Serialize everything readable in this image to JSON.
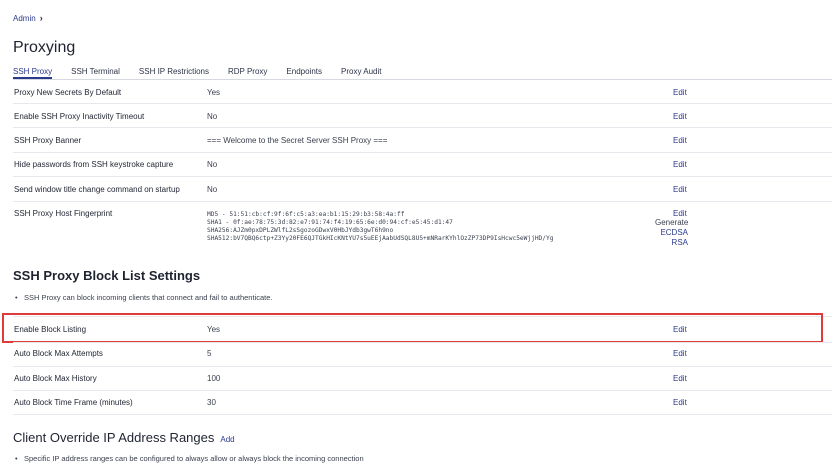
{
  "breadcrumb": {
    "label": "Admin"
  },
  "page": {
    "title": "Proxying"
  },
  "tabs": [
    {
      "label": "SSH Proxy",
      "active": true
    },
    {
      "label": "SSH Terminal"
    },
    {
      "label": "SSH IP Restrictions"
    },
    {
      "label": "RDP Proxy"
    },
    {
      "label": "Endpoints"
    },
    {
      "label": "Proxy Audit"
    }
  ],
  "settings": [
    {
      "label": "Proxy New Secrets By Default",
      "value": "Yes",
      "edit": "Edit"
    },
    {
      "label": "Enable SSH Proxy Inactivity Timeout",
      "value": "No",
      "edit": "Edit"
    },
    {
      "label": "SSH Proxy Banner",
      "value": "=== Welcome to the Secret Server SSH Proxy ===",
      "edit": "Edit"
    },
    {
      "label": "Hide passwords from SSH keystroke capture",
      "value": "No",
      "edit": "Edit"
    },
    {
      "label": "Send window title change command on startup",
      "value": "No",
      "edit": "Edit"
    },
    {
      "label": "SSH Proxy Host Fingerprint",
      "edit": "Edit"
    }
  ],
  "fingerprint": {
    "md5": "MD5 - 51:51:cb:cf:9f:6f:c5:a3:ea:b1:15:29:b3:58:4a:ff",
    "sha1": "SHA1 - 0f:ae:78:75:3d:82:e7:91:74:f4:19:65:6e:d0:94:cf:e5:45:d1:47",
    "sha256": "SHA256:AJZm0pxDPLZWlfL2sSgozoGDwxV0HbJYdb3gwT6h9no",
    "sha512": "SHA512:bV7QBQ6ctp+Z3Yy20FE6QJTGkHIcKNtYU7s5uEEjAabUdSQL8U5+mNRarKYhlOzZP73DP9IsHcwc5eWjjHD/Yg",
    "generate": "Generate",
    "ecdsa": "ECDSA",
    "rsa": "RSA"
  },
  "block_list": {
    "title": "SSH Proxy Block List Settings",
    "note": "SSH Proxy can block incoming clients that connect and fail to authenticate.",
    "rows": [
      {
        "label": "Enable Block Listing",
        "value": "Yes",
        "edit": "Edit"
      },
      {
        "label": "Auto Block Max Attempts",
        "value": "5",
        "edit": "Edit"
      },
      {
        "label": "Auto Block Max History",
        "value": "100",
        "edit": "Edit"
      },
      {
        "label": "Auto Block Time Frame (minutes)",
        "value": "30",
        "edit": "Edit"
      }
    ]
  },
  "override": {
    "title": "Client Override IP Address Ranges",
    "add": "Add",
    "note": "Specific IP address ranges can be configured to always allow or always block the incoming connection"
  },
  "colors": {
    "accent": "#2b3a8c",
    "highlight": "#e03b3b"
  }
}
